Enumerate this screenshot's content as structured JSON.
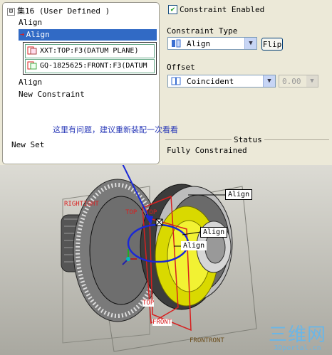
{
  "tree": {
    "root_label": "集16 (User Defined )",
    "expander": "⊟",
    "items": [
      {
        "label": "Align"
      },
      {
        "label": "Align"
      },
      {
        "label": "Align"
      },
      {
        "label": "New Constraint"
      },
      {
        "label": "New Set"
      }
    ],
    "refs": [
      {
        "label": "XXT:TOP:F3(DATUM PLANE)"
      },
      {
        "label": "GQ-1825625:FRONT:F3(DATUM"
      }
    ]
  },
  "panel": {
    "constraint_enabled_label": "Constraint Enabled",
    "constraint_enabled": true,
    "constraint_type_label": "Constraint Type",
    "constraint_type_value": "Align",
    "flip_label": "Flip",
    "offset_label": "Offset",
    "offset_value": "Coincident",
    "offset_number": "0.00",
    "status_label": "Status",
    "status_value": "Fully Constrained"
  },
  "annotation": "这里有问题，建议重新装配一次看看",
  "viewport": {
    "flags": [
      {
        "label": "Align"
      },
      {
        "label": "Align"
      },
      {
        "label": "Align"
      }
    ],
    "datum_tags": {
      "righttight": "RIGHTIGHT",
      "toptop": "TOP",
      "toptop2": "TOP",
      "top": "TOP",
      "front": "FRONT",
      "frontront": "FRONTRONT"
    }
  },
  "watermark": {
    "big": "三维网",
    "small": "3Dportal.cn"
  },
  "colors": {
    "selection": "#316ac5",
    "annotation": "#2a3ab8",
    "datum": "#d81f1f",
    "part": "#e6e600"
  }
}
